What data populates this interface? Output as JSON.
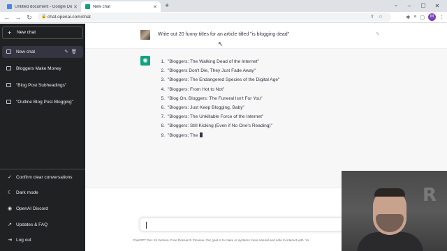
{
  "browser": {
    "tabs": [
      {
        "title": "Untitled document - Google Do...",
        "favicon_color": "#4285f4"
      },
      {
        "title": "New chat",
        "favicon_color": "#10a37f"
      }
    ],
    "url": "chat.openai.com/chat",
    "profile_initial": "M"
  },
  "sidebar": {
    "new_chat": "New chat",
    "conversations": [
      {
        "label": "New chat"
      },
      {
        "label": "Bloggers Make Money"
      },
      {
        "label": "\"Blog Post Subheadings\""
      },
      {
        "label": "\"Outline Blog Post Blogging\""
      }
    ],
    "bottom": [
      {
        "label": "Confirm clear conversations",
        "icon": "check-icon"
      },
      {
        "label": "Dark mode",
        "icon": "moon-icon"
      },
      {
        "label": "OpenAI Discord",
        "icon": "discord-icon"
      },
      {
        "label": "Updates & FAQ",
        "icon": "external-link-icon"
      },
      {
        "label": "Log out",
        "icon": "logout-icon"
      }
    ]
  },
  "chat": {
    "user_prompt": "Write out 20 funny titles for an article titled \"is blogging dead\"",
    "response": [
      {
        "num": "1.",
        "text": "\"Bloggers: The Walking Dead of the Internet\""
      },
      {
        "num": "2.",
        "text": "\"Bloggers Don't Die, They Just Fade Away\""
      },
      {
        "num": "3.",
        "text": "\"Bloggers: The Endangered Species of the Digital Age\""
      },
      {
        "num": "4.",
        "text": "\"Bloggers: From Hot to Not\""
      },
      {
        "num": "5.",
        "text": "\"Blog On, Bloggers: The Funeral Isn't For You\""
      },
      {
        "num": "6.",
        "text": "\"Bloggers: Just Keep Blogging, Baby\""
      },
      {
        "num": "7.",
        "text": "\"Bloggers: The Unkillable Force of the Internet\""
      },
      {
        "num": "8.",
        "text": "\"Bloggers: Still Kicking (Even if No One's Reading)\""
      },
      {
        "num": "9.",
        "text": "\"Bloggers: The "
      }
    ]
  },
  "footer": {
    "link": "ChatGPT Dec 15 Version",
    "text": ". Free Research Preview. Our goal is to make AI systems more natural and safe to interact with. Yo"
  },
  "colors": {
    "sidebar_bg": "#202123",
    "accent": "#10a37f",
    "response_bg": "#f7f7f8"
  }
}
